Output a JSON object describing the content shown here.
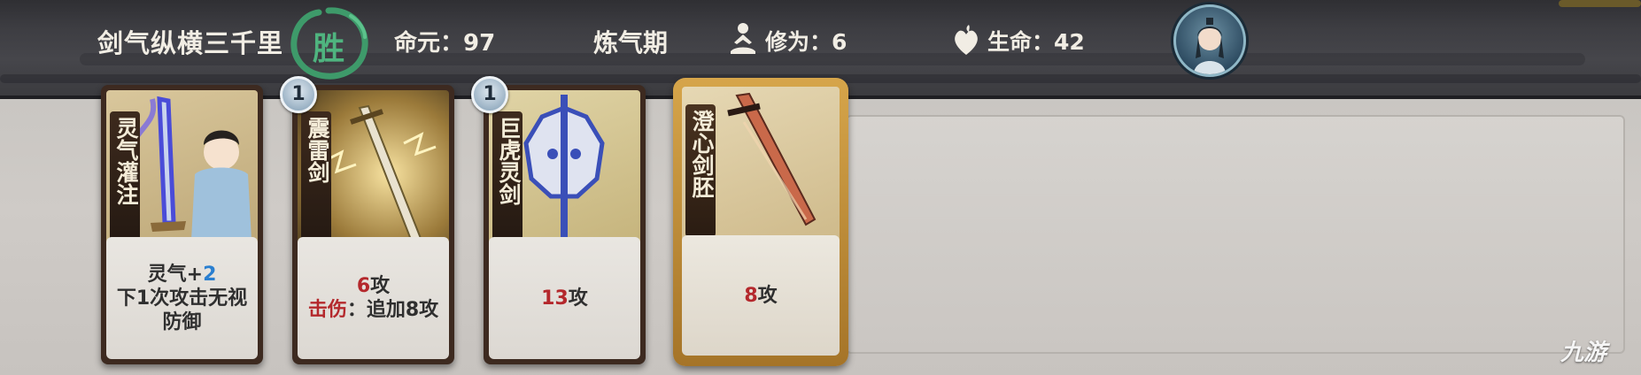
{
  "header": {
    "player_name": "剑气纵横三千里",
    "win_badge": "胜",
    "life": {
      "label": "命元：",
      "value": "97"
    },
    "realm": "炼气期",
    "cultivation": {
      "label": "修为：",
      "value": "6"
    },
    "health": {
      "label": "生命：",
      "value": "42"
    }
  },
  "cards": [
    {
      "name": "灵气灌注",
      "level": null,
      "desc_line1_a": "灵气+",
      "desc_line1_b": "2",
      "desc_line2": "下1次攻击无视",
      "desc_line3": "防御"
    },
    {
      "name": "震雷剑",
      "level": "1",
      "attack": "6",
      "attack_suffix": "攻",
      "keyword": "击伤",
      "keyword_rest": "：追加8攻"
    },
    {
      "name": "巨虎灵剑",
      "level": "1",
      "attack": "13",
      "attack_suffix": "攻"
    },
    {
      "name": "澄心剑胚",
      "level": null,
      "attack": "8",
      "attack_suffix": "攻"
    }
  ],
  "watermark": "九游",
  "colors": {
    "win": "#4fb47f",
    "attack": "#b4282c",
    "buff": "#2a7fd0",
    "card_frame": "#3d2a20",
    "golden_frame": "#d6a54a"
  }
}
